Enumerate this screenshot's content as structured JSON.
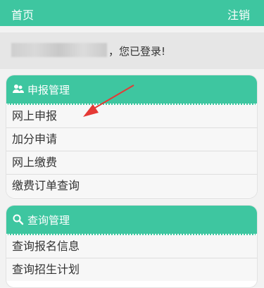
{
  "topbar": {
    "home": "首页",
    "logout": "注销"
  },
  "welcome": {
    "message": "，您已登录!"
  },
  "panels": [
    {
      "title": "申报管理",
      "icon": "users-icon",
      "items": [
        {
          "label": "网上申报"
        },
        {
          "label": "加分申请"
        },
        {
          "label": "网上缴费"
        },
        {
          "label": "缴费订单查询"
        }
      ]
    },
    {
      "title": "查询管理",
      "icon": "search-icon",
      "items": [
        {
          "label": "查询报名信息"
        },
        {
          "label": "查询招生计划"
        }
      ]
    }
  ],
  "colors": {
    "accent": "#3ec6a0",
    "annotation": "#e53935"
  }
}
